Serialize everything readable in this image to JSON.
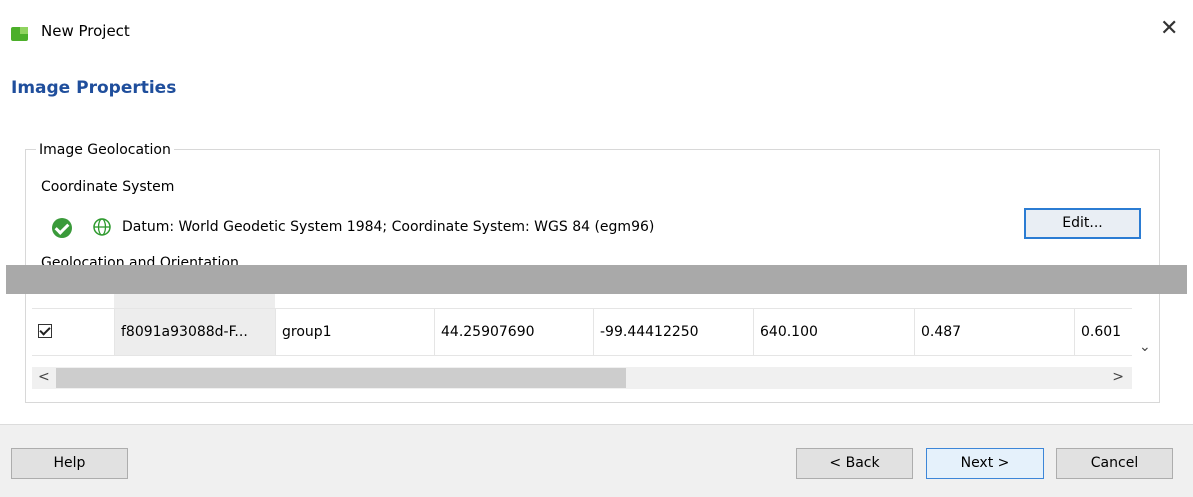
{
  "window": {
    "title": "New Project",
    "close_symbol": "✕"
  },
  "page": {
    "section_title": "Image Properties"
  },
  "geolocation": {
    "group_label": "Image Geolocation",
    "coordinate_system_label": "Coordinate System",
    "datum_text": "Datum: World Geodetic System 1984; Coordinate System: WGS 84 (egm96)",
    "edit_button": "Edit...",
    "geolocation_orientation_label": "Geolocation and Orientation",
    "status_icon": "check-circle-icon",
    "globe_icon": "globe-icon"
  },
  "table": {
    "rows": [
      {
        "checked": true,
        "name": "f8091a93088d-F...",
        "group": "group1",
        "latitude": "44.25907690",
        "longitude": "-99.44412250",
        "altitude": "640.100",
        "accuracy_horizontal": "0.487",
        "accuracy_vertical": "0.601"
      }
    ]
  },
  "scroll": {
    "left_arrow": "<",
    "right_arrow": ">",
    "down_arrow": "⌄"
  },
  "footer": {
    "help": "Help",
    "back": "< Back",
    "next": "Next >",
    "cancel": "Cancel"
  },
  "colors": {
    "section_title": "#1f4e9c",
    "app_icon": "#4caf2a",
    "status_ok": "#3a9a3a",
    "focus_border": "#2b7cd3"
  }
}
